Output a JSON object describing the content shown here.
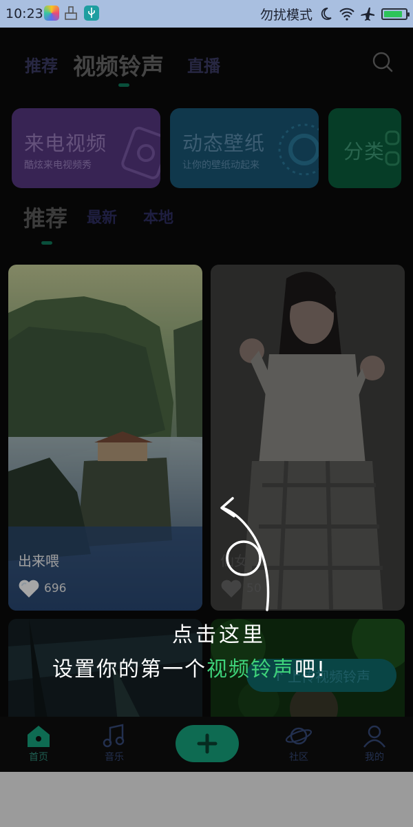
{
  "status_bar": {
    "time": "10:23",
    "dnd_label": "勿扰模式"
  },
  "top_tabs": [
    {
      "label": "推荐"
    },
    {
      "label": "视频铃声"
    },
    {
      "label": "直播"
    }
  ],
  "banners": [
    {
      "title": "来电视频",
      "subtitle": "酷炫来电视频秀",
      "color": "#5b3a86"
    },
    {
      "title": "动态壁纸",
      "subtitle": "让你的壁纸动起来",
      "color": "#1b5878"
    },
    {
      "title": "分类",
      "color": "#0b5f3c"
    }
  ],
  "sub_tabs": [
    {
      "label": "推荐"
    },
    {
      "label": "最新"
    },
    {
      "label": "本地"
    }
  ],
  "cards": [
    {
      "title": "出来喂",
      "likes": "696"
    },
    {
      "title": "仙女",
      "likes": "50"
    }
  ],
  "upload_label": "上传视频铃声",
  "overlay": {
    "line1": "点击这里",
    "line2_prefix": "设置你的第一个",
    "line2_highlight": "视频铃声",
    "line2_suffix": "吧!"
  },
  "bottom_nav": [
    {
      "label": "首页"
    },
    {
      "label": "音乐"
    },
    {
      "label": "社区"
    },
    {
      "label": "我的"
    }
  ],
  "colors": {
    "accent": "#0f7a5b",
    "highlight": "#3ed27a"
  }
}
